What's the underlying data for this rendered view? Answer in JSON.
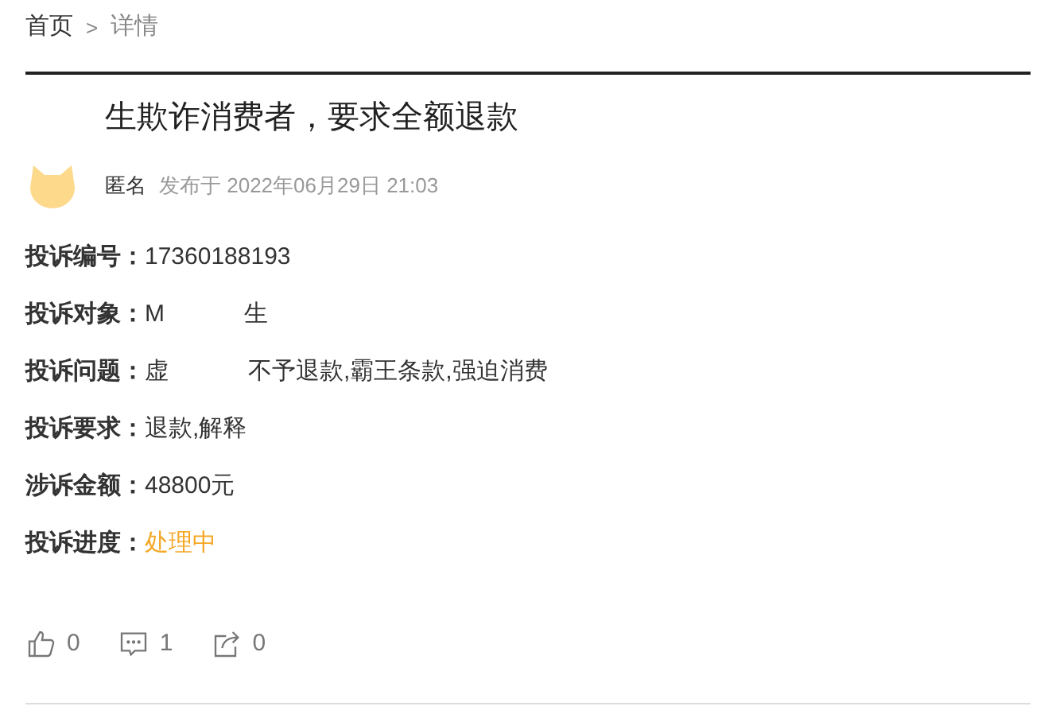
{
  "breadcrumb": [
    {
      "label": "首页"
    },
    {
      "label": "详情"
    }
  ],
  "breadcrumb_separator": ">",
  "title_fragments": [
    "生欺诈消费者，要求全额退款"
  ],
  "author": {
    "name": "匿名",
    "published": "发布于 2022年06月29日 21:03"
  },
  "fields": [
    {
      "label": "投诉编号：",
      "fragments": [
        "17360188193"
      ]
    },
    {
      "label": "投诉对象：",
      "fragments": [
        "M",
        "生"
      ]
    },
    {
      "label": "投诉问题：",
      "fragments": [
        "虚",
        "不予退款,霸王条款,强迫消费"
      ]
    },
    {
      "label": "投诉要求：",
      "fragments": [
        "退款,解释"
      ]
    },
    {
      "label": "涉诉金额：",
      "fragments": [
        "48800元"
      ]
    },
    {
      "label": "投诉进度：",
      "fragments": [
        "处理中"
      ],
      "kind": "status"
    }
  ],
  "actions": [
    {
      "kind": "like",
      "count": "0"
    },
    {
      "kind": "comment",
      "count": "1"
    },
    {
      "kind": "share",
      "count": "0"
    }
  ]
}
